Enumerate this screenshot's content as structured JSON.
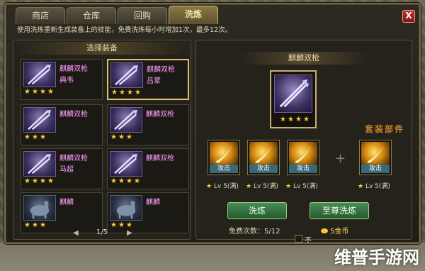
{
  "tabs": [
    {
      "label": "商店"
    },
    {
      "label": "仓库"
    },
    {
      "label": "回购"
    },
    {
      "label": "洗炼"
    }
  ],
  "close_label": "X",
  "hint": "使用洗炼重新生成装备上的技能，免费洗炼每小时增加1次，最多12次。",
  "left_panel": {
    "title": "选择装备",
    "items": [
      {
        "name": "麒麟双枪",
        "owner": "典韦",
        "stars": 4,
        "icon": "twin-spear-icon"
      },
      {
        "name": "麒麟双枪",
        "owner": "吕蒙",
        "stars": 4,
        "icon": "twin-spear-icon"
      },
      {
        "name": "麒麟双枪",
        "owner": "",
        "stars": 3,
        "icon": "twin-spear-icon"
      },
      {
        "name": "麒麟双枪",
        "owner": "",
        "stars": 3,
        "icon": "twin-spear-icon"
      },
      {
        "name": "麒麟双枪",
        "owner": "马超",
        "stars": 4,
        "icon": "twin-spear-icon"
      },
      {
        "name": "麒麟双枪",
        "owner": "",
        "stars": 4,
        "icon": "twin-spear-icon"
      },
      {
        "name": "麒麟",
        "owner": "",
        "stars": 3,
        "icon": "horse-icon"
      },
      {
        "name": "麒麟",
        "owner": "",
        "stars": 3,
        "icon": "horse-icon"
      }
    ],
    "pager": {
      "text": "1/5",
      "prev": "◀",
      "next": "▶"
    }
  },
  "right_panel": {
    "weapon_title": "麒麟双枪",
    "weapon_stars": 4,
    "set_label": "套装部件",
    "parts": [
      {
        "label": "攻击",
        "level": "Lv 5(满)"
      },
      {
        "label": "攻击",
        "level": "Lv 5(满)"
      },
      {
        "label": "攻击",
        "level": "Lv 5(满)"
      },
      {
        "label": "攻击",
        "level": "Lv 5(满)"
      }
    ],
    "plus": "+",
    "refine_button": "洗炼",
    "supreme_refine_button": "至尊洗炼",
    "free_count": "免费次数：5/12",
    "gold_cost": "5金币"
  },
  "bottom": {
    "checkbox_text": "不"
  },
  "watermark": "维普手游网",
  "colors": {
    "accent_gold": "#e0c070",
    "item_name_pink": "#ff9cff",
    "button_green": "#4a8c56",
    "star_yellow": "#ffc830",
    "close_red": "#c8302a"
  }
}
